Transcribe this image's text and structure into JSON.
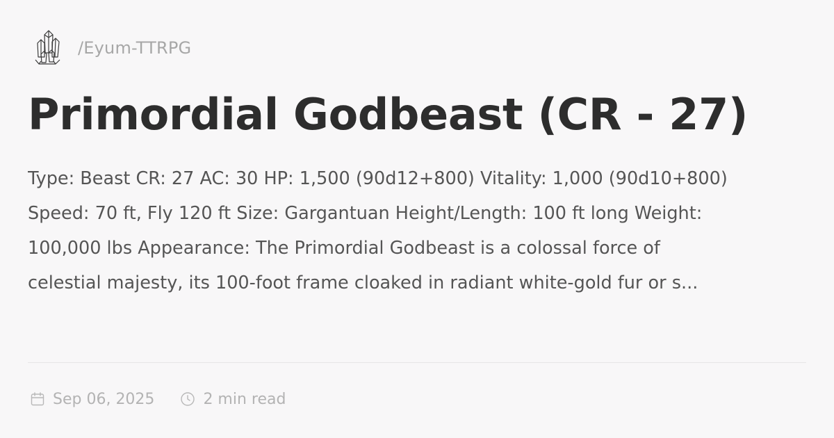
{
  "site": {
    "logo_icon": "crystal-cluster-icon",
    "path": "/Eyum-TTRPG"
  },
  "post": {
    "title": "Primordial Godbeast (CR - 27)",
    "excerpt_lines": [
      "Type: Beast CR: 27 AC: 30 HP: 1,500 (90d12+800) Vitality: 1,000 (90d10+800)",
      "Speed: 70 ft, Fly 120 ft Size: Gargantuan Height/Length: 100 ft long Weight:",
      "100,000 lbs Appearance: The Primordial Godbeast is a colossal force of",
      "celestial majesty, its 100-foot frame cloaked in radiant white-gold fur or s..."
    ]
  },
  "meta": {
    "date_icon": "calendar-icon",
    "date": "Sep 06, 2025",
    "read_icon": "clock-icon",
    "read_time": "2 min read"
  },
  "colors": {
    "background": "#f8f7f8",
    "title": "#2d2d2d",
    "body_text": "#555555",
    "muted_text": "#a7a7a7"
  }
}
